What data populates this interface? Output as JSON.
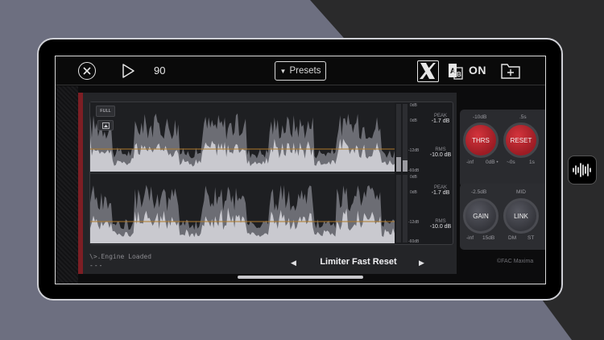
{
  "topbar": {
    "bpm": "90",
    "presets_label": "Presets",
    "on_label": "ON"
  },
  "icons": {
    "close": "close-icon",
    "play": "play-icon",
    "x_logo": "x-logo-icon",
    "ab_compare": "ab-compare-icon",
    "new_folder": "new-folder-icon",
    "image": "image-icon",
    "waveform_app": "waveform-app-icon"
  },
  "waveform": {
    "full_label": "FULL",
    "top": {
      "peak_label": "PEAK",
      "peak_value": "-1.7 dB",
      "rms_label": "RMS",
      "rms_value": "-10.0 dB"
    },
    "bottom": {
      "peak_label": "PEAK",
      "peak_value": "-1.7 dB",
      "rms_label": "RMS",
      "rms_value": "-10.0 dB"
    },
    "scale_top": [
      "0dB",
      "0dB",
      "-12dB",
      "-60dB"
    ],
    "scale_bottom": [
      "0dB",
      "0dB",
      "-12dB",
      "-60dB"
    ]
  },
  "status": {
    "line1": "\\>.Engine Loaded",
    "line2": "---"
  },
  "preset_nav": {
    "prev": "◀",
    "name": "Limiter Fast Reset",
    "next": "▶"
  },
  "controls": {
    "thrs": {
      "label": "THRS",
      "top": "-10dB",
      "min": "-inf",
      "max": "0dB •"
    },
    "reset": {
      "label": "RESET",
      "top": ".5s",
      "min": "~0s",
      "max": "1s"
    },
    "gain": {
      "label": "GAIN",
      "top": "-2.5dB",
      "min": "-inf",
      "max": "15dB"
    },
    "link": {
      "label": "LINK",
      "top": "MID",
      "min": "DM",
      "max": "ST"
    }
  },
  "copyright": "©FAC Maxima",
  "colors": {
    "accent_red": "#c0262e",
    "threshold_line": "#b07a2a",
    "waveform": "#c9c9cf"
  }
}
